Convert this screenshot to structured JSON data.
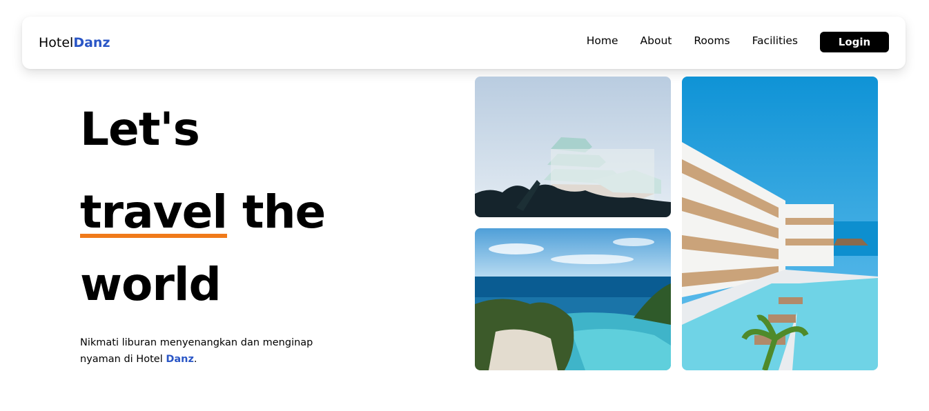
{
  "brand": {
    "prefix": "Hotel",
    "accent": "Danz"
  },
  "nav": {
    "links": [
      "Home",
      "About",
      "Rooms",
      "Facilities"
    ],
    "login_label": "Login"
  },
  "hero": {
    "line1": "Let's",
    "line2_highlight": "travel",
    "line2_rest": " the",
    "line3": "world",
    "description_prefix": "Nikmati liburan menyenangkan dan menginap nyaman di Hotel ",
    "description_accent": "Danz",
    "description_suffix": "."
  },
  "colors": {
    "accent_blue": "#2a56c6",
    "underline_orange": "#f07a1a",
    "button_black": "#000000"
  },
  "images": [
    {
      "name": "hotel-building-sky-photo"
    },
    {
      "name": "resort-pool-ocean-photo"
    },
    {
      "name": "hotel-pool-terrace-photo"
    }
  ]
}
